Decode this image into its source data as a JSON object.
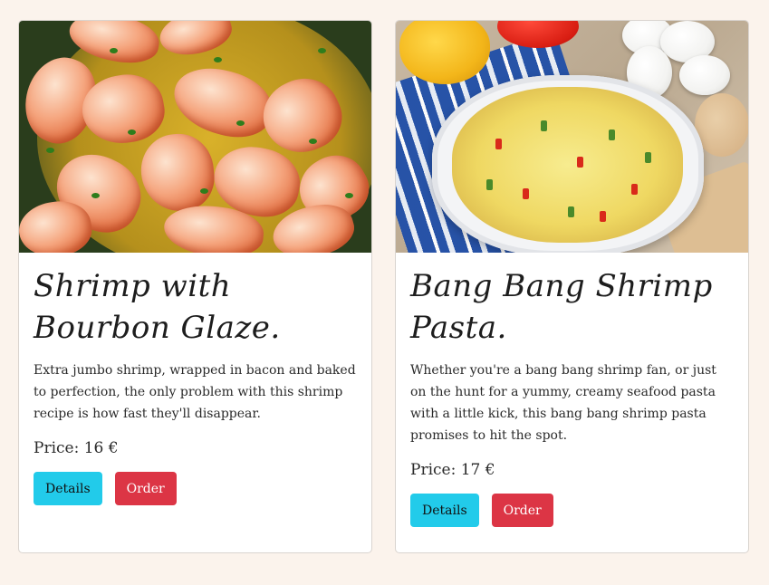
{
  "cards": [
    {
      "title": "Shrimp with Bourbon Glaze.",
      "description": "Extra jumbo shrimp, wrapped in bacon and baked to perfection, the only problem with this shrimp recipe is how fast they'll disappear.",
      "price": "Price: 16 €",
      "details_label": "Details",
      "order_label": "Order",
      "image_alt": "shrimp-dish-photo"
    },
    {
      "title": "Bang Bang Shrimp Pasta.",
      "description": "Whether you're a bang bang shrimp fan, or just on the hunt for a yummy, creamy seafood pasta with a little kick, this bang bang shrimp pasta promises to hit the spot.",
      "price": "Price: 17 €",
      "details_label": "Details",
      "order_label": "Order",
      "image_alt": "frittata-dish-photo"
    }
  ],
  "colors": {
    "page_background": "#fbf3ec",
    "details_button": "#22cbea",
    "order_button": "#dc3545"
  }
}
